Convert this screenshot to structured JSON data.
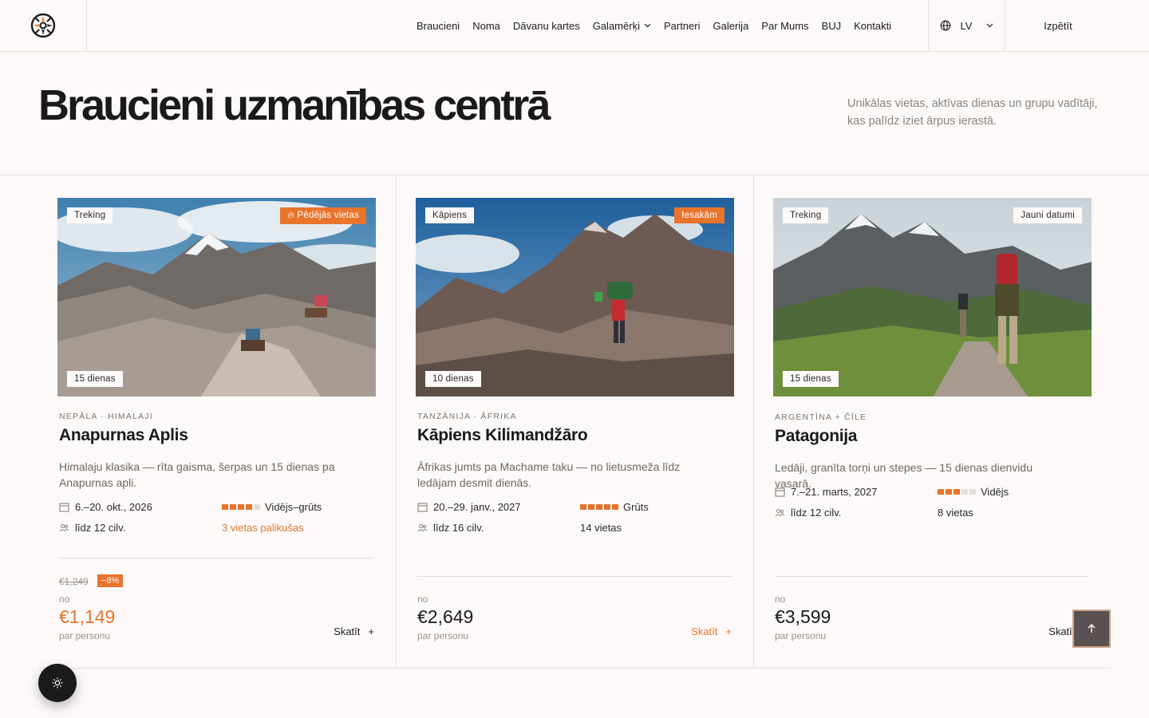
{
  "nav": {
    "items": [
      "Braucieni",
      "Noma",
      "Dāvanu kartes",
      "Galamērķi",
      "Partneri",
      "Galerija",
      "Par Mums",
      "BUJ",
      "Kontakti"
    ],
    "language": "LV",
    "cta": "Izpētīt"
  },
  "hero": {
    "title": "Braucieni uzmanības centrā",
    "subtitle": "Unikālas vietas, aktīvas dienas un grupu vadītāji, kas palīdz iziet ārpus ierastā."
  },
  "cards": [
    {
      "type": "Treking",
      "badge": "Pēdējās vietas",
      "duration": "15 dienas",
      "region": "Nepāla · Himalaji",
      "title": "Anapurnas Aplis",
      "description": "Himalaju klasika — rīta gaisma, šerpas un 15 dienas pa Anapurnas apli.",
      "dates": "6.–20. okt., 2026",
      "difficulty": "Vidējs–grūts",
      "difficulty_level": 4,
      "group": "līdz 12 cilv.",
      "seats": "3 vietas palikušas",
      "old_price": "€1,249",
      "discount": "−8%",
      "from": "no",
      "price": "€1,149",
      "per": "par personu",
      "view": "Skatīt"
    },
    {
      "type": "Kāpiens",
      "badge": "Iesakām",
      "duration": "10 dienas",
      "region": "Tanzānija · Āfrika",
      "title": "Kāpiens Kilimandžāro",
      "description": "Āfrikas jumts pa Machame taku — no lietusmeža līdz ledājam desmit dienās.",
      "dates": "20.–29. janv., 2027",
      "difficulty": "Grūts",
      "difficulty_level": 5,
      "group": "līdz 16 cilv.",
      "seats": "14 vietas",
      "from": "no",
      "price": "€2,649",
      "per": "par personu",
      "view": "Skatīt"
    },
    {
      "type": "Treking",
      "badge": "Jauni datumi",
      "duration": "15 dienas",
      "region": "Argentīna + Čīle",
      "title": "Patagonija",
      "description": "Ledāji, granīta torņi un stepes — 15 dienas dienvidu vasarā.",
      "dates": "7.–21. marts, 2027",
      "difficulty": "Vidējs",
      "difficulty_level": 3,
      "group": "līdz 12 cilv.",
      "seats": "8 vietas",
      "from": "no",
      "price": "€3,599",
      "per": "par personu",
      "view": "Skatīt"
    }
  ],
  "colors": {
    "accent": "#e9742c",
    "background": "#fdf9f8",
    "border": "#e6e1df"
  }
}
